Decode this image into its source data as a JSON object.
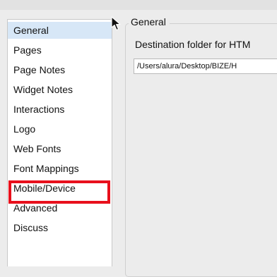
{
  "sidebar": {
    "items": [
      {
        "label": "General",
        "selected": true
      },
      {
        "label": "Pages"
      },
      {
        "label": "Page Notes"
      },
      {
        "label": "Widget Notes"
      },
      {
        "label": "Interactions"
      },
      {
        "label": "Logo"
      },
      {
        "label": "Web Fonts"
      },
      {
        "label": "Font Mappings"
      },
      {
        "label": "Mobile/Device",
        "highlighted": true
      },
      {
        "label": "Advanced"
      },
      {
        "label": "Discuss"
      }
    ]
  },
  "general": {
    "title": "General",
    "destination_label": "Destination folder for HTM",
    "destination_value": "/Users/alura/Desktop/BIZE/H"
  },
  "colors": {
    "selection": "#d7e7f7",
    "highlight_border": "#e8101c",
    "background": "#ececec"
  }
}
